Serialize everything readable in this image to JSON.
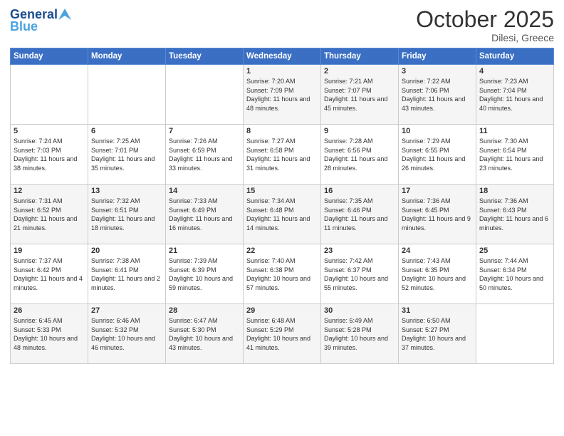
{
  "logo": {
    "line1": "General",
    "line2": "Blue"
  },
  "header": {
    "month": "October 2025",
    "location": "Dilesi, Greece"
  },
  "weekdays": [
    "Sunday",
    "Monday",
    "Tuesday",
    "Wednesday",
    "Thursday",
    "Friday",
    "Saturday"
  ],
  "weeks": [
    [
      {
        "day": "",
        "sunrise": "",
        "sunset": "",
        "daylight": ""
      },
      {
        "day": "",
        "sunrise": "",
        "sunset": "",
        "daylight": ""
      },
      {
        "day": "",
        "sunrise": "",
        "sunset": "",
        "daylight": ""
      },
      {
        "day": "1",
        "sunrise": "Sunrise: 7:20 AM",
        "sunset": "Sunset: 7:09 PM",
        "daylight": "Daylight: 11 hours and 48 minutes."
      },
      {
        "day": "2",
        "sunrise": "Sunrise: 7:21 AM",
        "sunset": "Sunset: 7:07 PM",
        "daylight": "Daylight: 11 hours and 45 minutes."
      },
      {
        "day": "3",
        "sunrise": "Sunrise: 7:22 AM",
        "sunset": "Sunset: 7:06 PM",
        "daylight": "Daylight: 11 hours and 43 minutes."
      },
      {
        "day": "4",
        "sunrise": "Sunrise: 7:23 AM",
        "sunset": "Sunset: 7:04 PM",
        "daylight": "Daylight: 11 hours and 40 minutes."
      }
    ],
    [
      {
        "day": "5",
        "sunrise": "Sunrise: 7:24 AM",
        "sunset": "Sunset: 7:03 PM",
        "daylight": "Daylight: 11 hours and 38 minutes."
      },
      {
        "day": "6",
        "sunrise": "Sunrise: 7:25 AM",
        "sunset": "Sunset: 7:01 PM",
        "daylight": "Daylight: 11 hours and 35 minutes."
      },
      {
        "day": "7",
        "sunrise": "Sunrise: 7:26 AM",
        "sunset": "Sunset: 6:59 PM",
        "daylight": "Daylight: 11 hours and 33 minutes."
      },
      {
        "day": "8",
        "sunrise": "Sunrise: 7:27 AM",
        "sunset": "Sunset: 6:58 PM",
        "daylight": "Daylight: 11 hours and 31 minutes."
      },
      {
        "day": "9",
        "sunrise": "Sunrise: 7:28 AM",
        "sunset": "Sunset: 6:56 PM",
        "daylight": "Daylight: 11 hours and 28 minutes."
      },
      {
        "day": "10",
        "sunrise": "Sunrise: 7:29 AM",
        "sunset": "Sunset: 6:55 PM",
        "daylight": "Daylight: 11 hours and 26 minutes."
      },
      {
        "day": "11",
        "sunrise": "Sunrise: 7:30 AM",
        "sunset": "Sunset: 6:54 PM",
        "daylight": "Daylight: 11 hours and 23 minutes."
      }
    ],
    [
      {
        "day": "12",
        "sunrise": "Sunrise: 7:31 AM",
        "sunset": "Sunset: 6:52 PM",
        "daylight": "Daylight: 11 hours and 21 minutes."
      },
      {
        "day": "13",
        "sunrise": "Sunrise: 7:32 AM",
        "sunset": "Sunset: 6:51 PM",
        "daylight": "Daylight: 11 hours and 18 minutes."
      },
      {
        "day": "14",
        "sunrise": "Sunrise: 7:33 AM",
        "sunset": "Sunset: 6:49 PM",
        "daylight": "Daylight: 11 hours and 16 minutes."
      },
      {
        "day": "15",
        "sunrise": "Sunrise: 7:34 AM",
        "sunset": "Sunset: 6:48 PM",
        "daylight": "Daylight: 11 hours and 14 minutes."
      },
      {
        "day": "16",
        "sunrise": "Sunrise: 7:35 AM",
        "sunset": "Sunset: 6:46 PM",
        "daylight": "Daylight: 11 hours and 11 minutes."
      },
      {
        "day": "17",
        "sunrise": "Sunrise: 7:36 AM",
        "sunset": "Sunset: 6:45 PM",
        "daylight": "Daylight: 11 hours and 9 minutes."
      },
      {
        "day": "18",
        "sunrise": "Sunrise: 7:36 AM",
        "sunset": "Sunset: 6:43 PM",
        "daylight": "Daylight: 11 hours and 6 minutes."
      }
    ],
    [
      {
        "day": "19",
        "sunrise": "Sunrise: 7:37 AM",
        "sunset": "Sunset: 6:42 PM",
        "daylight": "Daylight: 11 hours and 4 minutes."
      },
      {
        "day": "20",
        "sunrise": "Sunrise: 7:38 AM",
        "sunset": "Sunset: 6:41 PM",
        "daylight": "Daylight: 11 hours and 2 minutes."
      },
      {
        "day": "21",
        "sunrise": "Sunrise: 7:39 AM",
        "sunset": "Sunset: 6:39 PM",
        "daylight": "Daylight: 10 hours and 59 minutes."
      },
      {
        "day": "22",
        "sunrise": "Sunrise: 7:40 AM",
        "sunset": "Sunset: 6:38 PM",
        "daylight": "Daylight: 10 hours and 57 minutes."
      },
      {
        "day": "23",
        "sunrise": "Sunrise: 7:42 AM",
        "sunset": "Sunset: 6:37 PM",
        "daylight": "Daylight: 10 hours and 55 minutes."
      },
      {
        "day": "24",
        "sunrise": "Sunrise: 7:43 AM",
        "sunset": "Sunset: 6:35 PM",
        "daylight": "Daylight: 10 hours and 52 minutes."
      },
      {
        "day": "25",
        "sunrise": "Sunrise: 7:44 AM",
        "sunset": "Sunset: 6:34 PM",
        "daylight": "Daylight: 10 hours and 50 minutes."
      }
    ],
    [
      {
        "day": "26",
        "sunrise": "Sunrise: 6:45 AM",
        "sunset": "Sunset: 5:33 PM",
        "daylight": "Daylight: 10 hours and 48 minutes."
      },
      {
        "day": "27",
        "sunrise": "Sunrise: 6:46 AM",
        "sunset": "Sunset: 5:32 PM",
        "daylight": "Daylight: 10 hours and 46 minutes."
      },
      {
        "day": "28",
        "sunrise": "Sunrise: 6:47 AM",
        "sunset": "Sunset: 5:30 PM",
        "daylight": "Daylight: 10 hours and 43 minutes."
      },
      {
        "day": "29",
        "sunrise": "Sunrise: 6:48 AM",
        "sunset": "Sunset: 5:29 PM",
        "daylight": "Daylight: 10 hours and 41 minutes."
      },
      {
        "day": "30",
        "sunrise": "Sunrise: 6:49 AM",
        "sunset": "Sunset: 5:28 PM",
        "daylight": "Daylight: 10 hours and 39 minutes."
      },
      {
        "day": "31",
        "sunrise": "Sunrise: 6:50 AM",
        "sunset": "Sunset: 5:27 PM",
        "daylight": "Daylight: 10 hours and 37 minutes."
      },
      {
        "day": "",
        "sunrise": "",
        "sunset": "",
        "daylight": ""
      }
    ]
  ]
}
